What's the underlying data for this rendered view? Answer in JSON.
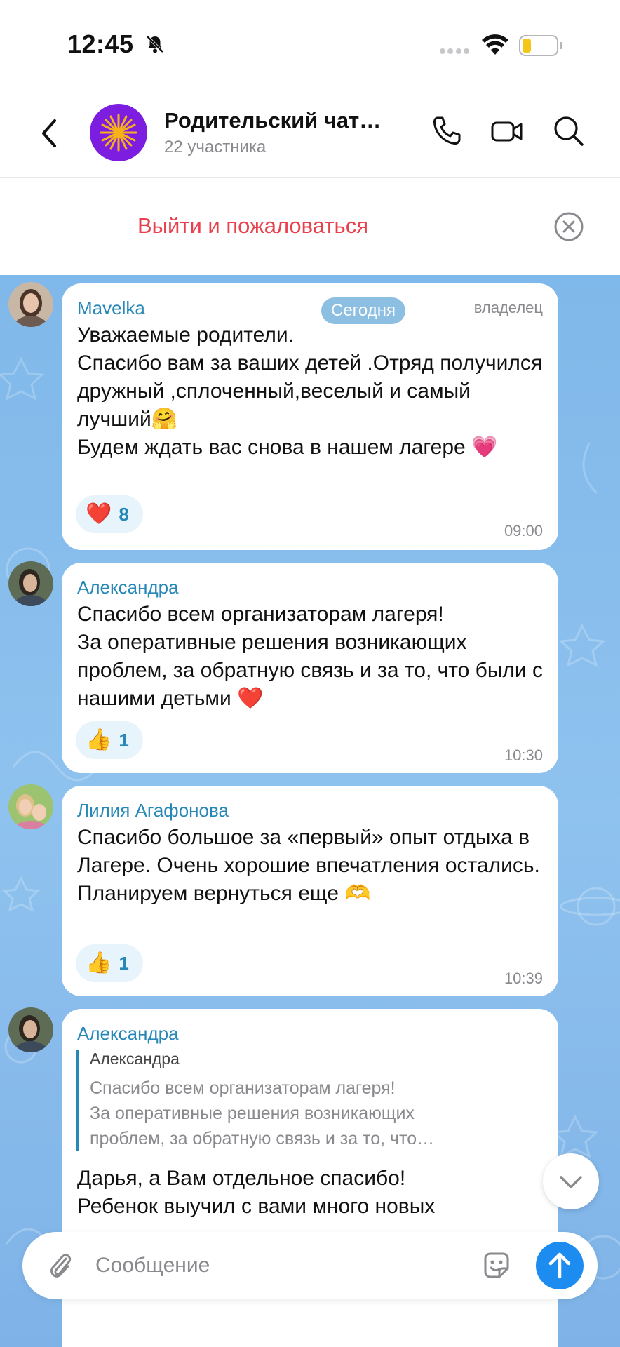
{
  "status_bar": {
    "time": "12:45",
    "bell_icon": "bell-slash-icon",
    "wifi_icon": "wifi-icon",
    "battery_icon": "battery-low-icon"
  },
  "header": {
    "title": "Родительский чат…",
    "subtitle": "22 участника",
    "back_icon": "chevron-left-icon",
    "call_icon": "phone-icon",
    "video_icon": "video-camera-icon",
    "search_icon": "search-icon"
  },
  "banner": {
    "text": "Выйти и пожаловаться",
    "close_icon": "close-circle-icon"
  },
  "date_label": "Сегодня",
  "messages": [
    {
      "sender": "Mavelka",
      "role": "владелец",
      "text": "Уважаемые родители.\nСпасибо вам за ваших детей .Отряд получился дружный ,сплоченный,веселый и самый лучший🤗\nБудем ждать вас снова в нашем лагере 💗",
      "reaction_emoji": "❤️",
      "reaction_count": "8",
      "time": "09:00"
    },
    {
      "sender": "Александра",
      "text": "Спасибо всем организаторам лагеря!\nЗа оперативные решения возникающих проблем, за обратную связь и за то, что были с нашими детьми ❤️",
      "reaction_emoji": "👍",
      "reaction_count": "1",
      "time": "10:30"
    },
    {
      "sender": "Лилия Агафонова",
      "text": "Спасибо большое за «первый» опыт отдыха в Лагере. Очень хорошие впечатления остались. Планируем вернуться еще 🫶",
      "reaction_emoji": "👍",
      "reaction_count": "1",
      "time": "10:39"
    },
    {
      "sender": "Александра",
      "reply_name": "Александра",
      "reply_text": "Спасибо всем организаторам лагеря!\nЗа оперативные решения возникающих\nпроблем, за обратную связь и за то, что…",
      "text": "Дарья, а Вам отдельное спасибо!\nРебенок выучил с вами много новых"
    }
  ],
  "input": {
    "placeholder": "Сообщение",
    "attach_icon": "paperclip-icon",
    "sticker_icon": "sticker-icon",
    "send_icon": "arrow-up-icon"
  },
  "colors": {
    "accent": "#2788b8",
    "danger": "#e8414d",
    "send": "#1c8cf0",
    "chat_bg": "#86bceb"
  }
}
